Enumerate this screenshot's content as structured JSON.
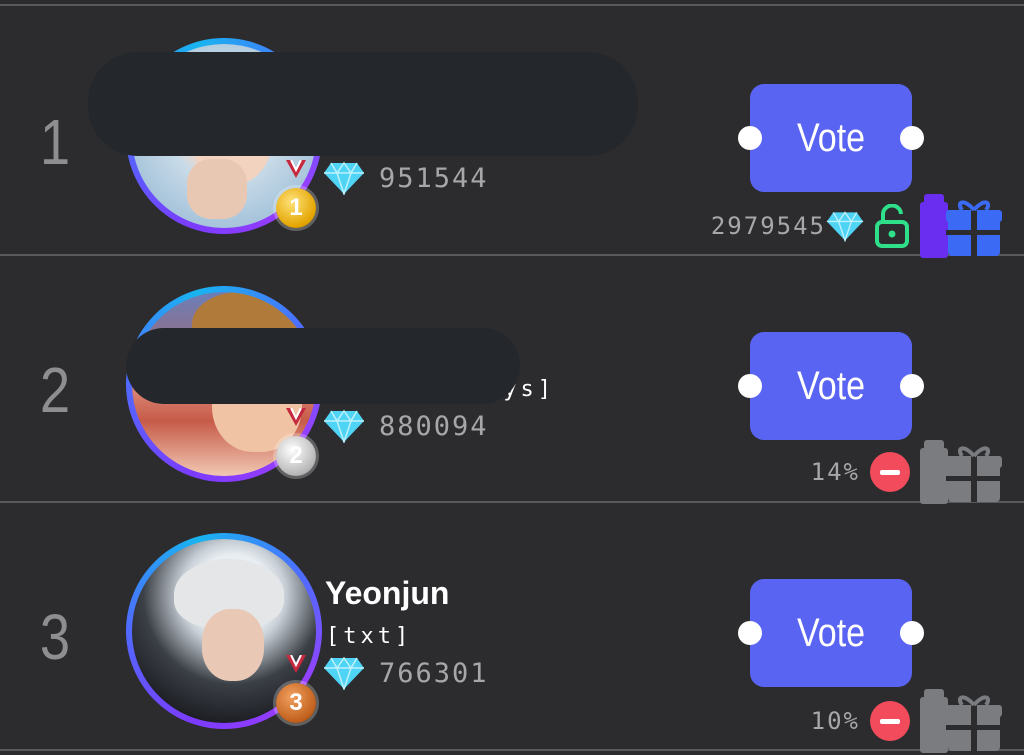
{
  "leaderboard": [
    {
      "rank": "1",
      "name": "",
      "group": "",
      "gems": "951544",
      "medal": "1",
      "vote_label": "Vote",
      "meta_text": "2979545",
      "meta_icon": "unlock-icon",
      "gift_style": "colored"
    },
    {
      "rank": "2",
      "name": "",
      "group": "oys]",
      "gems": "880094",
      "medal": "2",
      "vote_label": "Vote",
      "meta_text": "14%",
      "meta_icon": "minus-circle-icon",
      "gift_style": "gray"
    },
    {
      "rank": "3",
      "name": "Yeonjun",
      "group": "[txt]",
      "gems": "766301",
      "medal": "3",
      "vote_label": "Vote",
      "meta_text": "10%",
      "meta_icon": "minus-circle-icon",
      "gift_style": "gray"
    }
  ],
  "colors": {
    "background": "#2c2c2e",
    "vote_button": "#5a64f2",
    "unlock_icon": "#2ee08a",
    "minus_icon": "#f24b5b",
    "gem": "#4fd4f5"
  }
}
